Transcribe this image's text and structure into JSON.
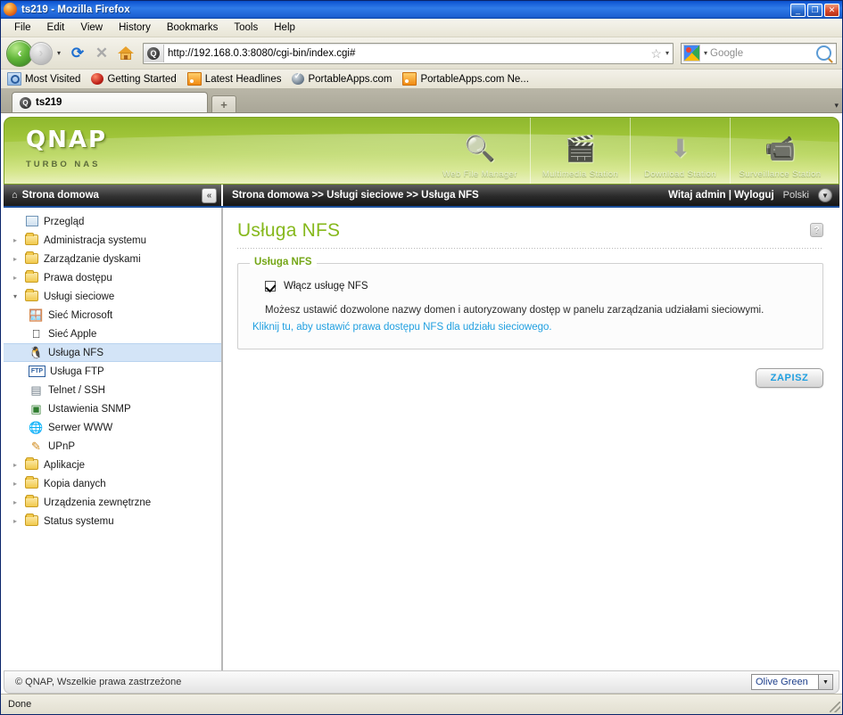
{
  "browser": {
    "title": "ts219 - Mozilla Firefox",
    "window_buttons": {
      "minimize": "_",
      "maximize": "❐",
      "close": "✕"
    },
    "menu": [
      "File",
      "Edit",
      "View",
      "History",
      "Bookmarks",
      "Tools",
      "Help"
    ],
    "nav": {
      "back": "‹",
      "forward": "›",
      "dropdown": "▾",
      "reload": "⟳",
      "stop": "✕",
      "home": "home-icon",
      "url": "http://192.168.0.3:8080/cgi-bin/index.cgi#",
      "bookmark_star": "☆",
      "url_dropdown": "▾",
      "search_placeholder": "Google",
      "search_engine_dropdown": "▾"
    },
    "bookmarks": [
      {
        "label": "Most Visited",
        "icon": "most-visited-icon"
      },
      {
        "label": "Getting Started",
        "icon": "firefox-icon"
      },
      {
        "label": "Latest Headlines",
        "icon": "rss-icon"
      },
      {
        "label": "PortableApps.com",
        "icon": "portableapps-icon"
      },
      {
        "label": "PortableApps.com Ne...",
        "icon": "rss-icon"
      }
    ],
    "tab": {
      "label": "ts219",
      "new_tab": "+",
      "list_all": "▾"
    },
    "status": "Done"
  },
  "qnap": {
    "brand": {
      "name": "QNAP",
      "tagline": "TURBO NAS"
    },
    "stations": [
      {
        "label": "Web File Manager",
        "icon": "folder-magnifier-icon",
        "glyph": "🔍"
      },
      {
        "label": "Multimedia Station",
        "icon": "multimedia-icon",
        "glyph": "🎬"
      },
      {
        "label": "Download Station",
        "icon": "download-icon",
        "glyph": "⬇"
      },
      {
        "label": "Surveillance Station",
        "icon": "camera-icon",
        "glyph": "📹"
      }
    ],
    "navstrip": {
      "home_label": "Strona domowa",
      "home_icon": "home-icon",
      "collapse_icon": "«",
      "breadcrumb": "Strona domowa >> Usługi sieciowe >> Usługa NFS",
      "welcome": "Witaj admin | Wyloguj",
      "language": "Polski",
      "language_icon": "▼"
    },
    "sidebar": [
      {
        "label": "Przegląd",
        "level": 0,
        "arrow": "none",
        "icon": "overview-icon",
        "selected": false
      },
      {
        "label": "Administracja systemu",
        "level": 0,
        "arrow": "closed",
        "icon": "folder-icon",
        "selected": false
      },
      {
        "label": "Zarządzanie dyskami",
        "level": 0,
        "arrow": "closed",
        "icon": "folder-icon",
        "selected": false
      },
      {
        "label": "Prawa dostępu",
        "level": 0,
        "arrow": "closed",
        "icon": "folder-icon",
        "selected": false
      },
      {
        "label": "Usługi sieciowe",
        "level": 0,
        "arrow": "open",
        "icon": "folder-open-icon",
        "selected": false
      },
      {
        "label": "Sieć Microsoft",
        "level": 1,
        "arrow": "none",
        "icon": "windows-icon",
        "glyph": "🪟",
        "selected": false
      },
      {
        "label": "Sieć Apple",
        "level": 1,
        "arrow": "none",
        "icon": "apple-icon",
        "glyph": "",
        "selected": false
      },
      {
        "label": "Usługa NFS",
        "level": 1,
        "arrow": "none",
        "icon": "linux-penguin-icon",
        "glyph": "🐧",
        "selected": true
      },
      {
        "label": "Usługa FTP",
        "level": 1,
        "arrow": "none",
        "icon": "ftp-icon",
        "glyph": "",
        "selected": false
      },
      {
        "label": "Telnet / SSH",
        "level": 1,
        "arrow": "none",
        "icon": "terminal-icon",
        "glyph": "",
        "selected": false
      },
      {
        "label": "Ustawienia SNMP",
        "level": 1,
        "arrow": "none",
        "icon": "snmp-icon",
        "glyph": "",
        "selected": false
      },
      {
        "label": "Serwer WWW",
        "level": 1,
        "arrow": "none",
        "icon": "globe-icon",
        "glyph": "🌐",
        "selected": false
      },
      {
        "label": "UPnP",
        "level": 1,
        "arrow": "none",
        "icon": "upnp-icon",
        "glyph": "",
        "selected": false
      },
      {
        "label": "Aplikacje",
        "level": 0,
        "arrow": "closed",
        "icon": "folder-icon",
        "selected": false
      },
      {
        "label": "Kopia danych",
        "level": 0,
        "arrow": "closed",
        "icon": "folder-icon",
        "selected": false
      },
      {
        "label": "Urządzenia zewnętrzne",
        "level": 0,
        "arrow": "closed",
        "icon": "folder-icon",
        "selected": false
      },
      {
        "label": "Status systemu",
        "level": 0,
        "arrow": "closed",
        "icon": "folder-icon",
        "selected": false
      }
    ],
    "page": {
      "title": "Usługa NFS",
      "help_icon": "?",
      "fieldset_legend": "Usługa NFS",
      "checkbox_label": "Włącz usługę NFS",
      "checkbox_checked": true,
      "description": "Możesz ustawić dozwolone nazwy domen i autoryzowany dostęp w panelu zarządzania udziałami sieciowymi.",
      "link": "Kliknij tu, aby ustawić prawa dostępu NFS dla udziału sieciowego.",
      "save_label": "ZAPISZ"
    },
    "footer": {
      "copyright": "© QNAP, Wszelkie prawa zastrzeżone",
      "theme": "Olive Green",
      "theme_arrow": "▼"
    },
    "colors": {
      "accent_green": "#86b81c",
      "legend_green": "#74a616",
      "link_blue": "#1f9fe0",
      "selected_row": "#d3e4f7"
    }
  }
}
